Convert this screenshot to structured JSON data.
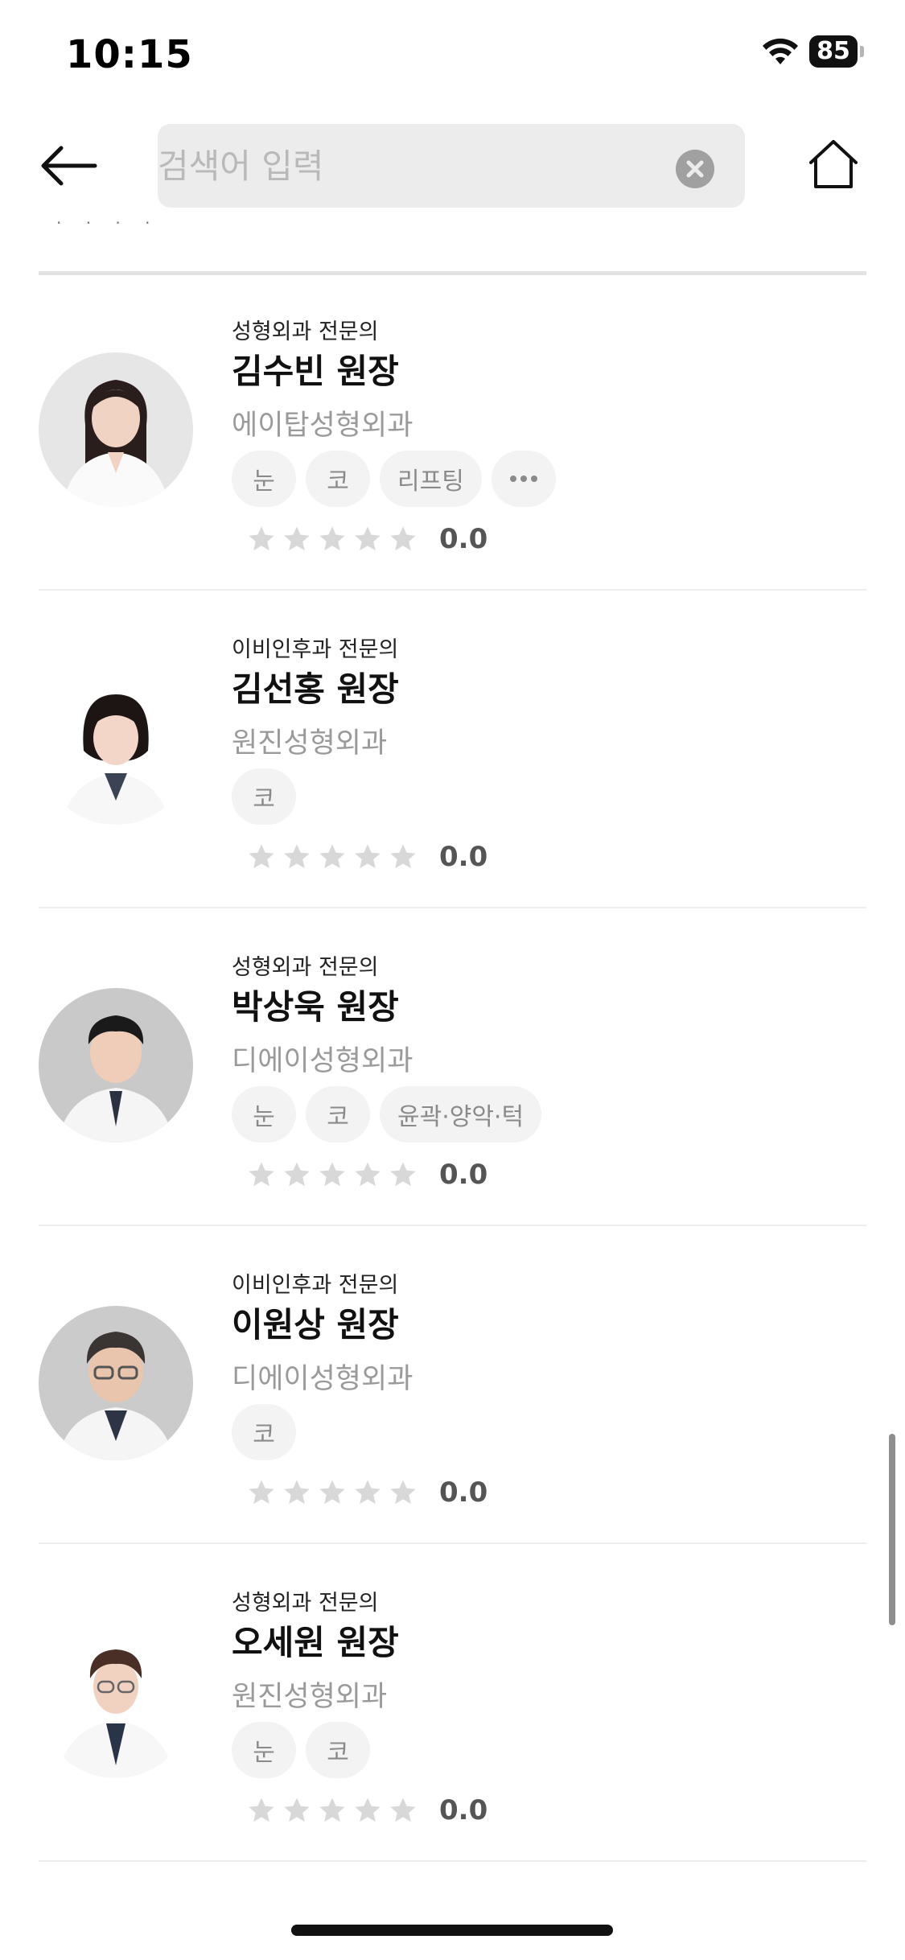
{
  "status": {
    "time": "10:15",
    "battery": "85"
  },
  "search": {
    "placeholder": "검색어 입력",
    "value": ""
  },
  "icons": {
    "back": "arrow-left-icon",
    "clear": "clear-circle-icon",
    "home": "home-icon",
    "star": "star-icon",
    "more": "more-dots-icon"
  },
  "colors": {
    "star_empty": "#d8d8d8",
    "tag_bg": "#f3f3f3",
    "hospital_text": "#9a9a9a"
  },
  "doctors": [
    {
      "specialty": "성형외과 전문의",
      "name": "김수빈 원장",
      "hospital": "에이탑성형외과",
      "tags": [
        "눈",
        "코",
        "리프팅"
      ],
      "more_tag": true,
      "rating": "0.0",
      "stars": 0
    },
    {
      "specialty": "이비인후과 전문의",
      "name": "김선홍 원장",
      "hospital": "원진성형외과",
      "tags": [
        "코"
      ],
      "more_tag": false,
      "rating": "0.0",
      "stars": 0
    },
    {
      "specialty": "성형외과 전문의",
      "name": "박상욱 원장",
      "hospital": "디에이성형외과",
      "tags": [
        "눈",
        "코",
        "윤곽·양악·턱"
      ],
      "more_tag": false,
      "rating": "0.0",
      "stars": 0
    },
    {
      "specialty": "이비인후과 전문의",
      "name": "이원상 원장",
      "hospital": "디에이성형외과",
      "tags": [
        "코"
      ],
      "more_tag": false,
      "rating": "0.0",
      "stars": 0
    },
    {
      "specialty": "성형외과 전문의",
      "name": "오세원 원장",
      "hospital": "원진성형외과",
      "tags": [
        "눈",
        "코"
      ],
      "more_tag": false,
      "rating": "0.0",
      "stars": 0
    }
  ]
}
